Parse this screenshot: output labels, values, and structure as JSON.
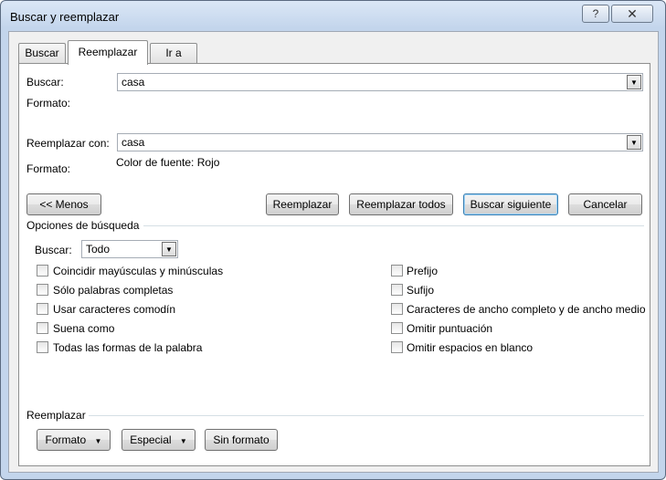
{
  "window": {
    "title": "Buscar y reemplazar",
    "help_glyph": "?",
    "close_glyph": "✕"
  },
  "tabs": [
    {
      "label": "Buscar"
    },
    {
      "label": "Reemplazar"
    },
    {
      "label": "Ir a"
    }
  ],
  "active_tab": "Reemplazar",
  "find": {
    "label": "Buscar:",
    "value": "casa",
    "format_label": "Formato:",
    "format_value": ""
  },
  "replace": {
    "label": "Reemplazar con:",
    "value": "casa",
    "format_label": "Formato:",
    "format_value": "Color de fuente: Rojo"
  },
  "buttons": {
    "less": "<< Menos",
    "replace": "Reemplazar",
    "replace_all": "Reemplazar todos",
    "find_next": "Buscar siguiente",
    "cancel": "Cancelar"
  },
  "search_options": {
    "heading": "Opciones de búsqueda",
    "direction_label": "Buscar:",
    "direction_value": "Todo",
    "left": [
      {
        "label": "Coincidir mayúsculas y minúsculas",
        "checked": false
      },
      {
        "label": "Sólo palabras completas",
        "checked": false
      },
      {
        "label": "Usar caracteres comodín",
        "checked": false
      },
      {
        "label": "Suena como",
        "checked": false
      },
      {
        "label": "Todas las formas de la palabra",
        "checked": false
      }
    ],
    "right": [
      {
        "label": "Prefijo",
        "checked": false
      },
      {
        "label": "Sufijo",
        "checked": false
      },
      {
        "label": "Caracteres de ancho completo y de ancho medio",
        "checked": false
      },
      {
        "label": "Omitir puntuación",
        "checked": false
      },
      {
        "label": "Omitir espacios en blanco",
        "checked": false
      }
    ]
  },
  "replace_section": {
    "heading": "Reemplazar",
    "format_button": "Formato",
    "special_button": "Especial",
    "no_format_button": "Sin formato",
    "dropdown_glyph": "▼"
  },
  "icons": {
    "combo_arrow": "▼"
  }
}
